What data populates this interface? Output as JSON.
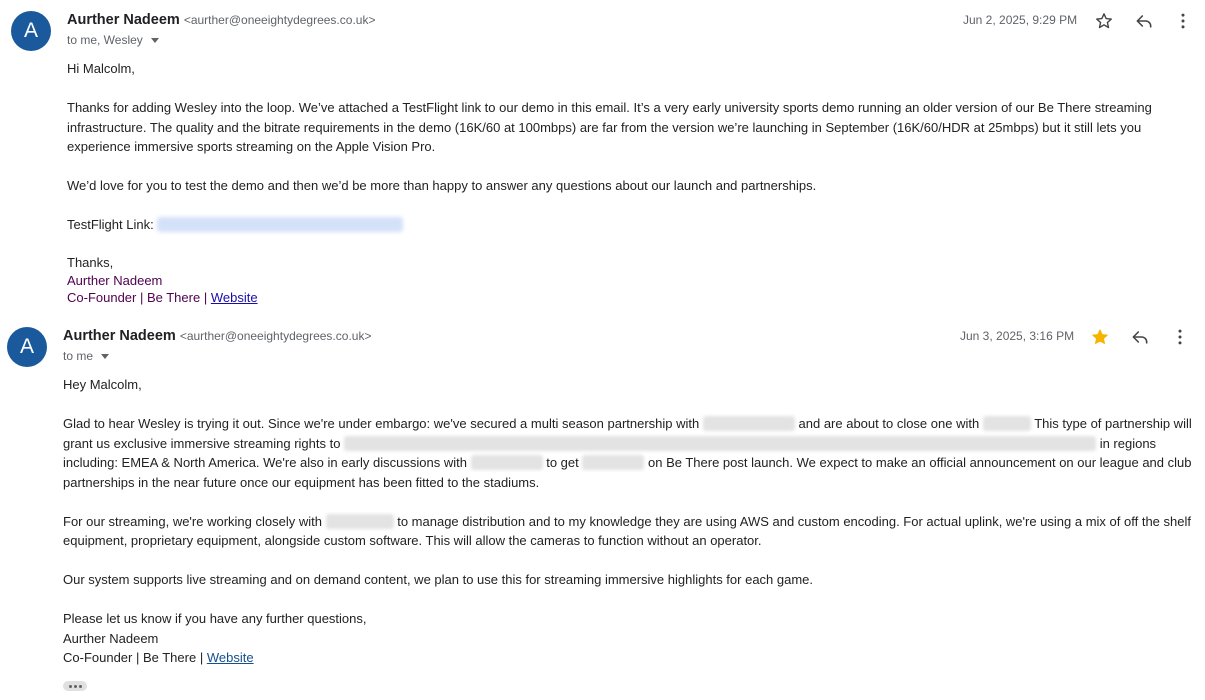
{
  "messages": [
    {
      "avatar_letter": "A",
      "sender_name": "Aurther Nadeem",
      "sender_email": "<aurther@oneeightydegrees.co.uk>",
      "recipients": "to me, Wesley",
      "date": "Jun 2, 2025, 9:29 PM",
      "starred": false,
      "greeting": "Hi Malcolm,",
      "p1": "Thanks for adding Wesley into the loop. We’ve attached a TestFlight link to our demo in this email. It’s a very early university sports demo running an older version of our Be There streaming infrastructure. The quality and the bitrate requirements in the demo (16K/60 at 100mbps) are far from the version we’re launching in September (16K/60/HDR at 25mbps) but it still lets you experience immersive sports streaming on the Apple Vision Pro.",
      "p2": "We’d love for you to test the demo and then we’d be more than happy to answer any questions about our launch and partnerships.",
      "testflight_label": "TestFlight Link:",
      "closing": "Thanks,",
      "sig_name": "Aurther Nadeem",
      "sig_title": "Co-Founder | Be There |",
      "sig_link": "Website"
    },
    {
      "avatar_letter": "A",
      "sender_name": "Aurther Nadeem",
      "sender_email": "<aurther@oneeightydegrees.co.uk>",
      "recipients": "to me",
      "date": "Jun 3, 2025, 3:16 PM",
      "starred": true,
      "greeting": "Hey Malcolm,",
      "p1_a": "Glad to hear Wesley is trying it out. Since we're under embargo: we've secured a multi season partnership with",
      "p1_b": "and are about to close one with",
      "p1_c": "This type of partnership will grant us exclusive immersive streaming rights to",
      "p1_d": "in regions including: EMEA & North America. We're also in early discussions with",
      "p1_e": "to get",
      "p1_f": "on Be There post launch. We expect to make an official announcement on our league and club partnerships in the near future once our equipment has been fitted to the stadiums.",
      "p2_a": "For our streaming, we're working closely with",
      "p2_b": "to manage distribution and to my knowledge they are using AWS and custom encoding. For actual uplink, we're using a mix of off the shelf equipment, proprietary equipment, alongside custom software. This will allow the cameras to function without an operator.",
      "p3": "Our system supports live streaming and on demand content, we plan to use this for streaming immersive highlights for each game.",
      "p4": "Please let us know if you have any further questions,",
      "sig_name": "Aurther Nadeem",
      "sig_title": "Co-Founder | Be There |",
      "sig_link": "Website"
    }
  ],
  "icons": {
    "star": "star-icon",
    "star_filled": "star-filled-icon",
    "reply": "reply-icon",
    "more": "more-vert-icon",
    "show_trimmed": "more-horiz-icon"
  },
  "colors": {
    "avatar_bg": "#1a5a9c",
    "star_filled": "#f4b400",
    "signature": "#500050",
    "link": "#15508f"
  }
}
